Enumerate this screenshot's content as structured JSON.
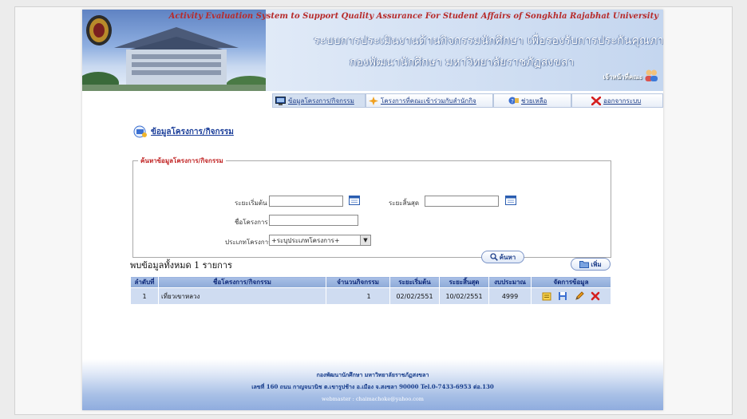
{
  "header": {
    "title_en": "Activity Evaluation System to Support Quality Assurance For Student Affairs of Songkhla Rajabhat University",
    "title_th_line1": "ระบบการประเมินงานด้านกิจกรรมนักศึกษา  เพื่อรองรับการประกันคุณภาพ",
    "title_th_line2": "กองพัฒนานักศึกษา  มหาวิทยาลัยราชภัฏสงขลา",
    "user_label": "เจ้าหน้าที่คณะ"
  },
  "menu": [
    {
      "label": "ข้อมูลโครงการ/กิจกรรม",
      "icon": "monitor-icon"
    },
    {
      "label": "โครงการที่คณะเข้าร่วมกับสำนักกิจ",
      "icon": "sparkle-icon"
    },
    {
      "label": "ช่วยเหลือ",
      "icon": "help-icon"
    },
    {
      "label": "ออกจากระบบ",
      "icon": "close-x-icon"
    }
  ],
  "section_title": "ข้อมูลโครงการ/กิจกรรม",
  "search": {
    "legend": "ค้นหาข้อมูลโครงการ/กิจกรรม",
    "start_label": "ระยะเริ่มต้น",
    "start_value": "",
    "end_label": "ระยะสิ้นสุด",
    "end_value": "",
    "name_label": "ชื่อโครงการ",
    "name_value": "",
    "type_label": "ประเภทโครงการ",
    "type_selected": "+ระบุประเภทโครงการ+",
    "search_button": "ค้นหา"
  },
  "results": {
    "found_text": "พบข้อมูลทั้งหมด 1 รายการ",
    "add_button": "เพิ่ม",
    "columns": [
      "ลำดับที่",
      "ชื่อโครงการ/กิจกรรม",
      "จำนวนกิจกรรม",
      "ระยะเริ่มต้น",
      "ระยะสิ้นสุด",
      "งบประมาณ",
      "จัดการข้อมูล"
    ],
    "rows": [
      {
        "no": "1",
        "name": "เที่ยวเขาหลวง",
        "count": "1",
        "start": "02/02/2551",
        "end": "10/02/2551",
        "budget": "4999"
      }
    ]
  },
  "footer": {
    "line1": "กองพัฒนานักศึกษา มหาวิทยาลัยราชภัฏสงขลา",
    "line2": "เลขที่ 160 ถนน กาญจนวนิช ต.เขารูปช้าง อ.เมือง จ.สงขลา 90000 Tel.0-7433-6953 ต่อ.130",
    "line3": "webmaster : chaimachoke@yahoo.com"
  },
  "colors": {
    "accent": "#1a3d99",
    "table_header": "#9bb5df",
    "table_row": "#cfdcf1",
    "title_en": "#b72b2b"
  }
}
